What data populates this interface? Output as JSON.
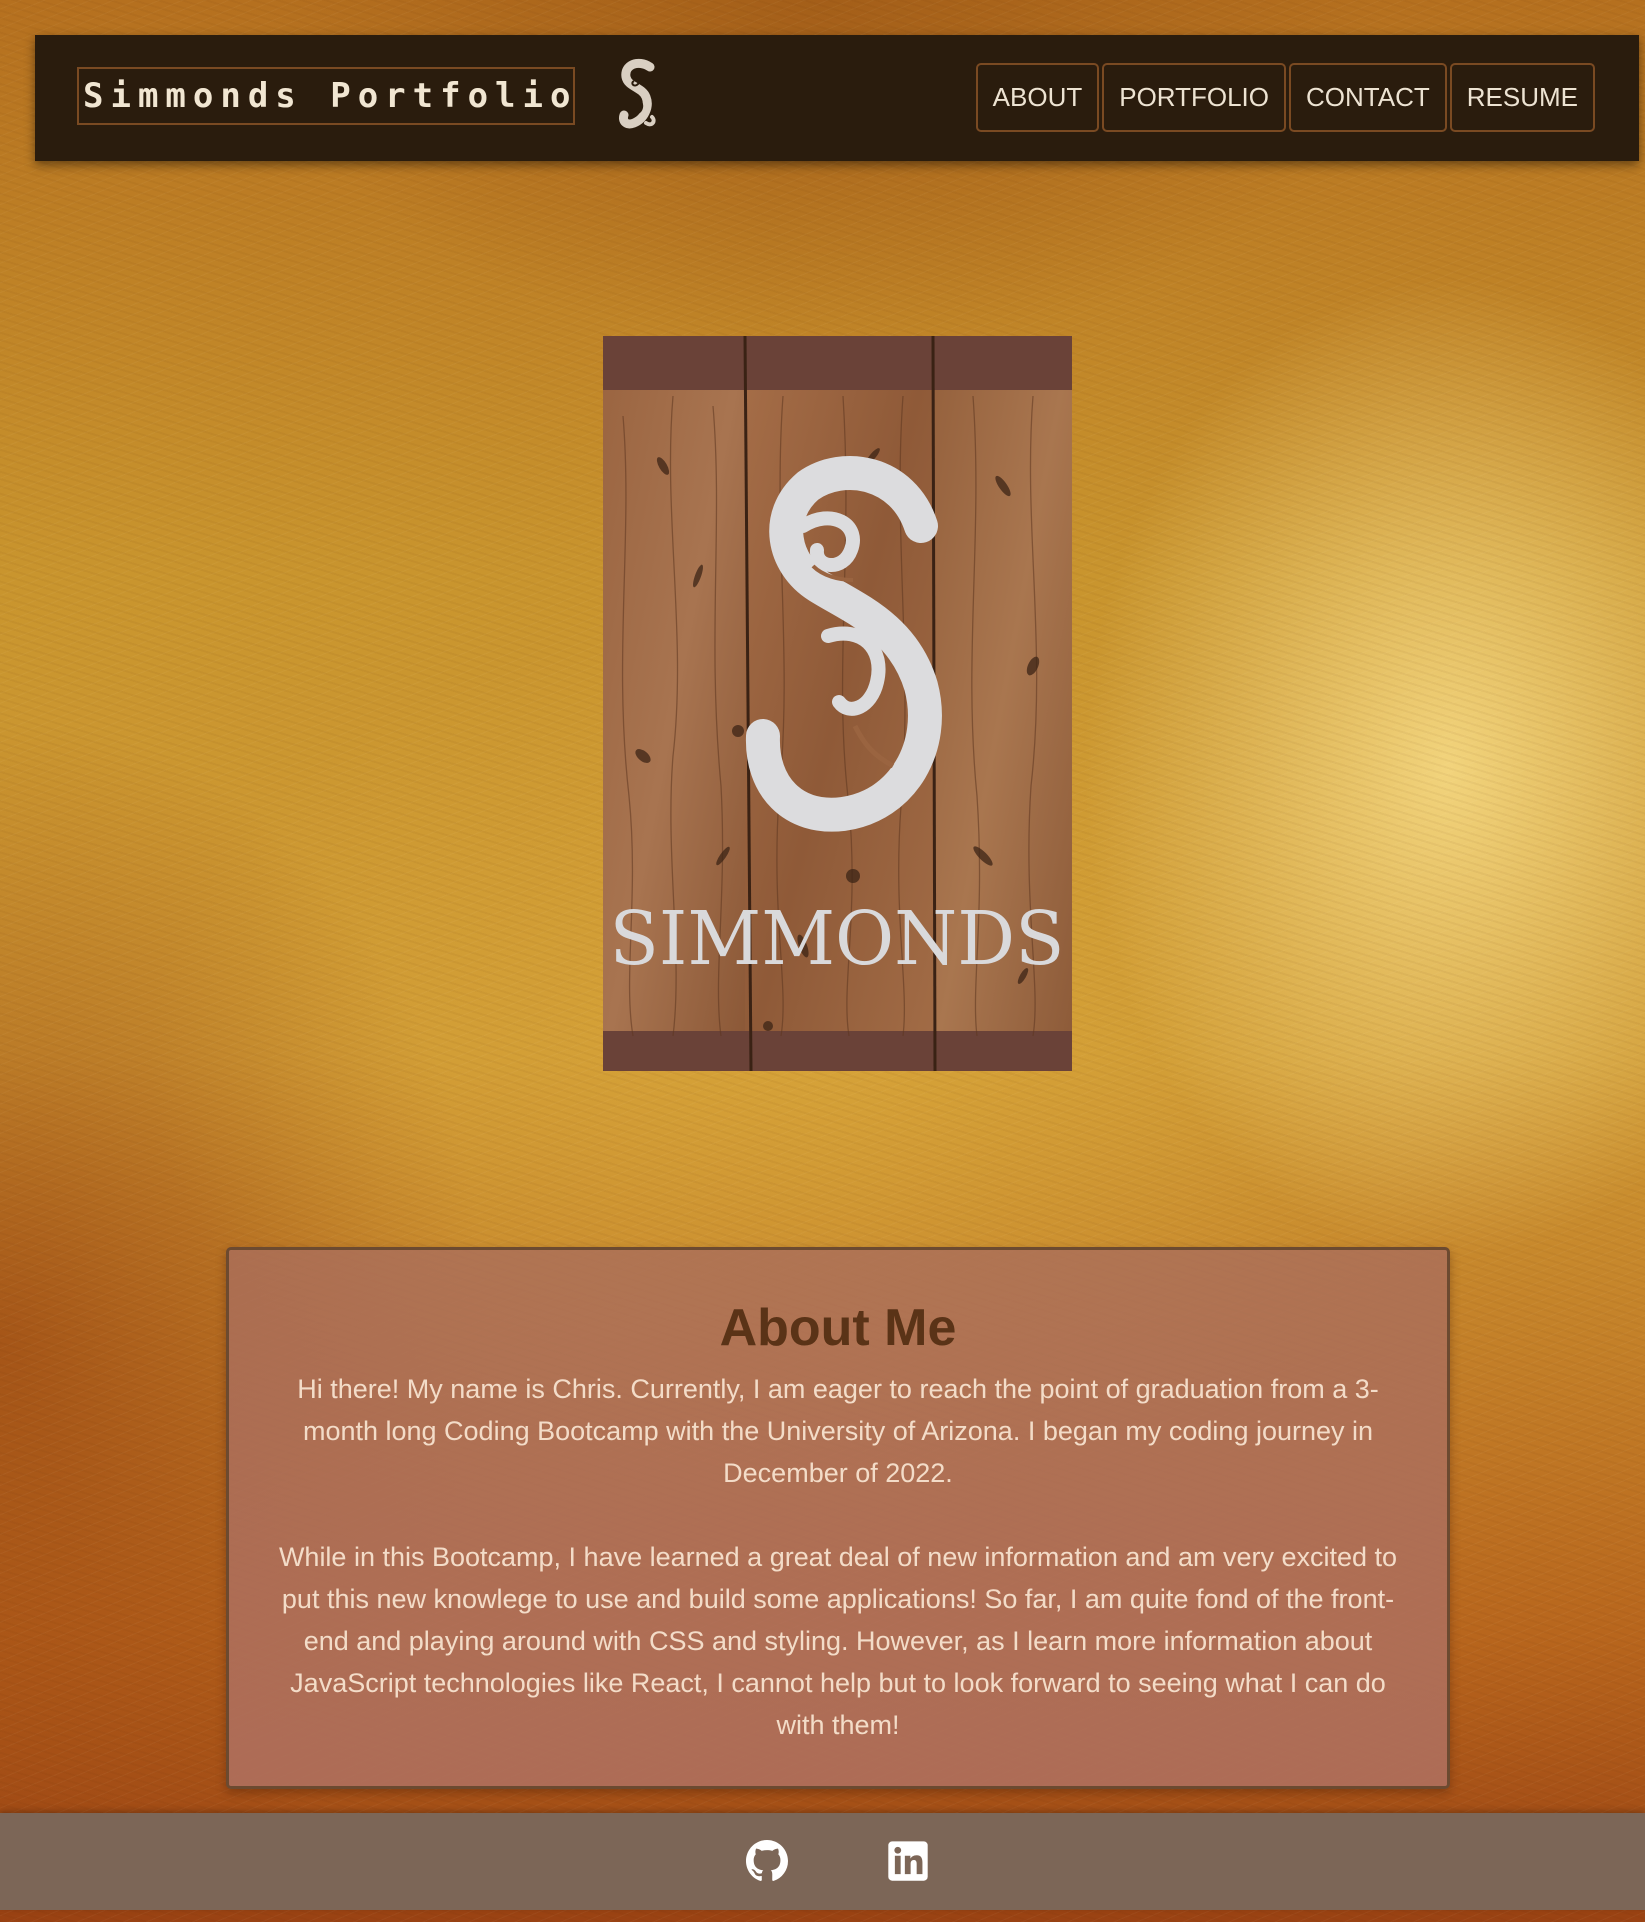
{
  "header": {
    "brand": "Simmonds Portfolio",
    "logo_icon": "ornate-s-monogram-icon",
    "nav": [
      "ABOUT",
      "PORTFOLIO",
      "CONTACT",
      "RESUME"
    ]
  },
  "hero": {
    "sign_text": "SIMMONDS",
    "icon": "ornate-s-monogram-icon"
  },
  "about": {
    "title": "About Me",
    "paragraphs": [
      "Hi there! My name is Chris. Currently, I am eager to reach the point of graduation from a 3-month long Coding Bootcamp with the University of Arizona. I began my coding journey in December of 2022.",
      "While in this Bootcamp, I have learned a great deal of new information and am very excited to put this new knowlege to use and build some applications! So far, I am quite fond of the front-end and playing around with CSS and styling. However, as I learn more information about JavaScript technologies like React, I cannot help but to look forward to seeing what I can do with them!"
    ]
  },
  "footer": {
    "icons": [
      "github-icon",
      "linkedin-icon"
    ]
  },
  "colors": {
    "navbar_bg": "#2a1c0d",
    "nav_border": "#7a4a22",
    "card_title": "#5a3317",
    "card_text": "#f3dcc8",
    "footer_bg": "#7c6657"
  }
}
